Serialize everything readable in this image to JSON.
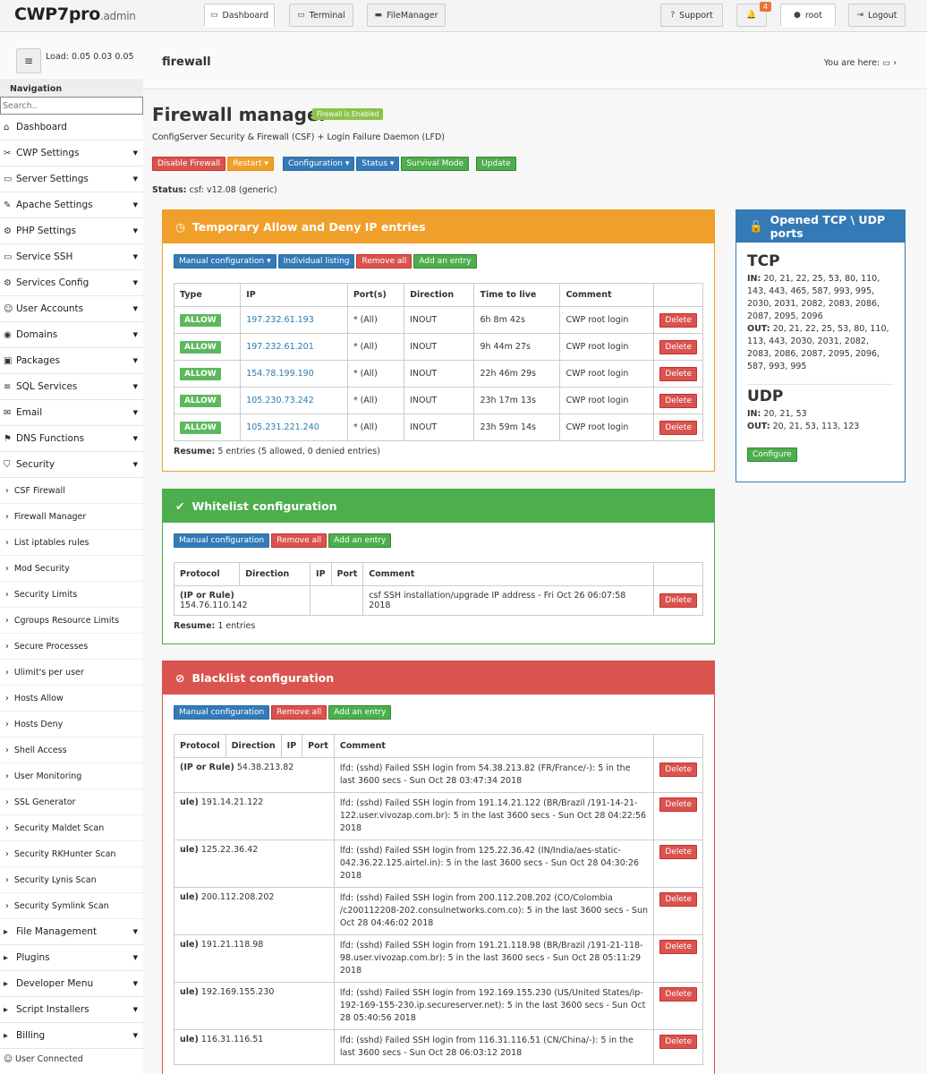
{
  "brand": {
    "name": "CWP7pro",
    "suffix": ".admin"
  },
  "topnav": {
    "dashboard": "Dashboard",
    "terminal": "Terminal",
    "filemanager": "FileManager",
    "support": "Support",
    "notif_count": "4",
    "user": "root",
    "logout": "Logout"
  },
  "subbar": {
    "load_label": "Load:",
    "load_values": "0.05  0.03  0.05",
    "breadcrumb": "firewall",
    "you_are_here": "You are here:"
  },
  "nav": {
    "header": "Navigation",
    "search_placeholder": "Search..",
    "items": [
      "Dashboard",
      "CWP Settings",
      "Server Settings",
      "Apache Settings",
      "PHP Settings",
      "Service SSH",
      "Services Config",
      "User Accounts",
      "Domains",
      "Packages",
      "SQL Services",
      "Email",
      "DNS Functions",
      "Security"
    ],
    "security_sub": [
      "CSF Firewall",
      "Firewall Manager",
      "List iptables rules",
      "Mod Security",
      "Security Limits",
      "Cgroups Resource Limits",
      "Secure Processes",
      "Ulimit's per user",
      "Hosts Allow",
      "Hosts Deny",
      "Shell Access",
      "User Monitoring",
      "SSL Generator",
      "Security Maldet Scan",
      "Security RKHunter Scan",
      "Security Lynis Scan",
      "Security Symlink Scan"
    ],
    "items_after": [
      "File Management",
      "Plugins",
      "Developer Menu",
      "Script Installers",
      "Billing"
    ],
    "footer": "User Connected"
  },
  "page": {
    "title": "Firewall manager",
    "enabled_badge": "Firewall is Enabled",
    "subtitle": "ConfigServer Security & Firewall (CSF) + Login Failure Daemon (LFD)",
    "buttons": {
      "disable": "Disable Firewall",
      "restart": "Restart",
      "configuration": "Configuration",
      "status": "Status",
      "survival": "Survival Mode",
      "update": "Update"
    },
    "status_label": "Status:",
    "status_value": "csf: v12.08 (generic)"
  },
  "temp": {
    "title": "Temporary Allow and Deny IP entries",
    "buttons": {
      "manual": "Manual configuration",
      "individual": "Individual listing",
      "remove": "Remove all",
      "add": "Add an entry"
    },
    "headers": [
      "Type",
      "IP",
      "Port(s)",
      "Direction",
      "Time to live",
      "Comment",
      ""
    ],
    "rows": [
      {
        "type": "ALLOW",
        "ip": "197.232.61.193",
        "port": "* (All)",
        "dir": "INOUT",
        "ttl": "6h 8m 42s",
        "comment": "CWP root login"
      },
      {
        "type": "ALLOW",
        "ip": "197.232.61.201",
        "port": "* (All)",
        "dir": "INOUT",
        "ttl": "9h 44m 27s",
        "comment": "CWP root login"
      },
      {
        "type": "ALLOW",
        "ip": "154.78.199.190",
        "port": "* (All)",
        "dir": "INOUT",
        "ttl": "22h 46m 29s",
        "comment": "CWP root login"
      },
      {
        "type": "ALLOW",
        "ip": "105.230.73.242",
        "port": "* (All)",
        "dir": "INOUT",
        "ttl": "23h 17m 13s",
        "comment": "CWP root login"
      },
      {
        "type": "ALLOW",
        "ip": "105.231.221.240",
        "port": "* (All)",
        "dir": "INOUT",
        "ttl": "23h 59m 14s",
        "comment": "CWP root login"
      }
    ],
    "resume_label": "Resume:",
    "resume": "5 entries (5 allowed, 0 denied entries)"
  },
  "white": {
    "title": "Whitelist configuration",
    "buttons": {
      "manual": "Manual configuration",
      "remove": "Remove all",
      "add": "Add an entry"
    },
    "headers": [
      "Protocol",
      "Direction",
      "IP",
      "Port",
      "Comment",
      ""
    ],
    "row": {
      "proto": "(IP or Rule)",
      "ip": "154.76.110.142",
      "comment": "csf SSH installation/upgrade IP address - Fri Oct 26 06:07:58 2018"
    },
    "resume_label": "Resume:",
    "resume": "1 entries"
  },
  "black": {
    "title": "Blacklist configuration",
    "buttons": {
      "manual": "Manual configuration",
      "remove": "Remove all",
      "add": "Add an entry"
    },
    "headers": [
      "Protocol",
      "Direction",
      "IP",
      "Port",
      "Comment",
      ""
    ],
    "rows": [
      {
        "proto": "(IP or Rule)",
        "ip": "54.38.213.82",
        "comment": "lfd: (sshd) Failed SSH login from 54.38.213.82 (FR/France/-): 5 in the last 3600 secs - Sun Oct 28 03:47:34 2018"
      },
      {
        "proto": "ule)",
        "ip": "191.14.21.122",
        "comment": "lfd: (sshd) Failed SSH login from 191.14.21.122 (BR/Brazil /191-14-21-122.user.vivozap.com.br): 5 in the last 3600 secs - Sun Oct 28 04:22:56 2018"
      },
      {
        "proto": "ule)",
        "ip": "125.22.36.42",
        "comment": "lfd: (sshd) Failed SSH login from 125.22.36.42 (IN/India/aes-static-042.36.22.125.airtel.in): 5 in the last 3600 secs - Sun Oct 28 04:30:26 2018"
      },
      {
        "proto": "ule)",
        "ip": "200.112.208.202",
        "comment": "lfd: (sshd) Failed SSH login from 200.112.208.202 (CO/Colombia /c200112208-202.consulnetworks.com.co): 5 in the last 3600 secs - Sun Oct 28 04:46:02 2018"
      },
      {
        "proto": "ule)",
        "ip": "191.21.118.98",
        "comment": "lfd: (sshd) Failed SSH login from 191.21.118.98 (BR/Brazil /191-21-118-98.user.vivozap.com.br): 5 in the last 3600 secs - Sun Oct 28 05:11:29 2018"
      },
      {
        "proto": "ule)",
        "ip": "192.169.155.230",
        "comment": "lfd: (sshd) Failed SSH login from 192.169.155.230 (US/United States/ip-192-169-155-230.ip.secureserver.net): 5 in the last 3600 secs - Sun Oct 28 05:40:56 2018"
      },
      {
        "proto": "ule)",
        "ip": "116.31.116.51",
        "comment": "lfd: (sshd) Failed SSH login from 116.31.116.51 (CN/China/-): 5 in the last 3600 secs - Sun Oct 28 06:03:12 2018"
      }
    ]
  },
  "ports": {
    "title": "Opened TCP \\ UDP ports",
    "tcp": "TCP",
    "in_label": "IN:",
    "out_label": "OUT:",
    "tcp_in": "20, 21, 22, 25, 53, 80, 110, 143, 443, 465, 587, 993, 995, 2030, 2031, 2082, 2083, 2086, 2087, 2095, 2096",
    "tcp_out": "20, 21, 22, 25, 53, 80, 110, 113, 443, 2030, 2031, 2082, 2083, 2086, 2087, 2095, 2096, 587, 993, 995",
    "udp": "UDP",
    "udp_in": "20, 21, 53",
    "udp_out": "20, 21, 53, 113, 123",
    "configure": "Configure"
  },
  "delete_label": "Delete",
  "colors": {
    "orange": "#f0a02a",
    "green": "#4cae4c",
    "red": "#d9534f",
    "blue": "#337ab7"
  }
}
